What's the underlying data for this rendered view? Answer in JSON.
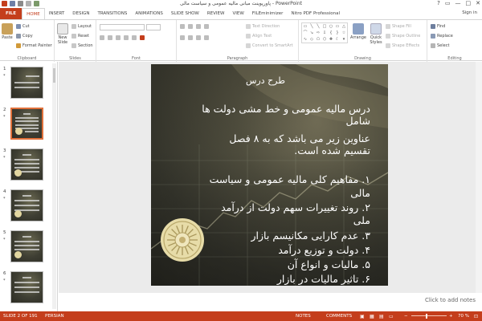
{
  "window": {
    "title": "پاورپوینت مبانی مالیه عمومی و سیاست مالی - PowerPoint",
    "controls": [
      "?",
      "▭",
      "—",
      "□",
      "✕"
    ]
  },
  "tabs": [
    {
      "label": "FILE"
    },
    {
      "label": "HOME"
    },
    {
      "label": "INSERT"
    },
    {
      "label": "DESIGN"
    },
    {
      "label": "TRANSITIONS"
    },
    {
      "label": "ANIMATIONS"
    },
    {
      "label": "SLIDE SHOW"
    },
    {
      "label": "REVIEW"
    },
    {
      "label": "VIEW"
    },
    {
      "label": "FILEminimizer"
    },
    {
      "label": "Nitro PDF Professional"
    }
  ],
  "signin": "Sign in",
  "ribbon": {
    "clipboard": {
      "paste": "Paste",
      "cut": "Cut",
      "copy": "Copy",
      "format_painter": "Format Painter",
      "label": "Clipboard"
    },
    "slides": {
      "new_slide": "New Slide",
      "layout": "Layout",
      "reset": "Reset",
      "section": "Section",
      "label": "Slides"
    },
    "font": {
      "label": "Font"
    },
    "paragraph": {
      "text_direction": "Text Direction",
      "align_text": "Align Text",
      "convert_smartart": "Convert to SmartArt",
      "label": "Paragraph"
    },
    "drawing": {
      "arrange": "Arrange",
      "quick_styles": "Quick Styles",
      "shape_fill": "Shape Fill",
      "shape_outline": "Shape Outline",
      "shape_effects": "Shape Effects",
      "label": "Drawing"
    },
    "editing": {
      "find": "Find",
      "replace": "Replace",
      "select": "Select",
      "label": "Editing"
    }
  },
  "thumbnails": [
    {
      "num": "1",
      "star": "*"
    },
    {
      "num": "2",
      "star": "*",
      "selected": true
    },
    {
      "num": "3",
      "star": "*"
    },
    {
      "num": "4",
      "star": "*"
    },
    {
      "num": "5",
      "star": "*"
    },
    {
      "num": "6",
      "star": "*"
    }
  ],
  "slide": {
    "title": "طرح درس",
    "lines": [
      "درس مالیه عمومی و خط مشی دولت ها",
      "شامل",
      "عناوین زیر می باشد که به ۸ فصل",
      "تقسیم شده است.",
      "۱. مفاهیم کلی مالیه عمومی و سیاست",
      "مالی",
      "۲. روند تغییرات سهم دولت از درآمد",
      "ملی",
      "۳. عدم کارایی مکانیسم بازار",
      "۴. دولت و توزیع درآمد",
      "۵. مالیات و انواع آن",
      "۶. تاثیر مالیات در بازار"
    ]
  },
  "notes_placeholder": "Click to add notes",
  "status": {
    "slide_count": "SLIDE 2 OF 191",
    "language": "PERSIAN",
    "notes": "NOTES",
    "comments": "COMMENTS",
    "zoom": "70 %",
    "zoom_fraction": 0.43
  },
  "colors": {
    "accent": "#c43e1c",
    "slide_text": "#ffffff",
    "seal": "#e7dca8"
  }
}
